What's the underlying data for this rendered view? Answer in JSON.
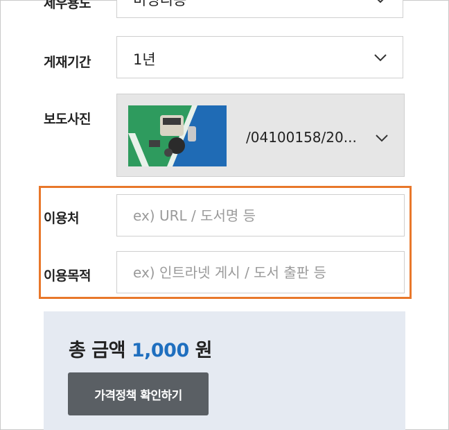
{
  "form": {
    "usage_type": {
      "label": "제우용도",
      "value": "비영리용"
    },
    "period": {
      "label": "게재기간",
      "value": "1년"
    },
    "photo": {
      "label": "보도사진",
      "path": "/04100158/20..."
    },
    "usage_place": {
      "label": "이용처",
      "placeholder": "ex) URL / 도서명 등",
      "value": ""
    },
    "usage_purpose": {
      "label": "이용목적",
      "placeholder": "ex) 인트라넷 게시 / 도서 출판 등",
      "value": ""
    }
  },
  "price": {
    "prefix": "총 금액",
    "amount": "1,000",
    "unit": "원",
    "policy_button": "가격정책 확인하기"
  },
  "colors": {
    "highlight_border": "#e8772a",
    "price_background": "#e5eaf2",
    "amount_blue": "#1f6fbf",
    "button_gray": "#5a5f64"
  },
  "icons": {
    "dropdown": "chevron-down-icon"
  }
}
